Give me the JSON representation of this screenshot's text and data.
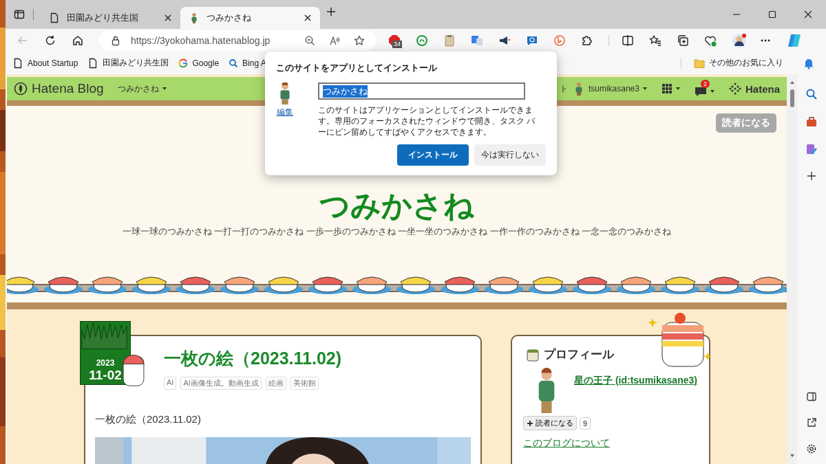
{
  "browser": {
    "tabs": [
      {
        "title": "田園みどり共生国",
        "selected": false
      },
      {
        "title": "つみかさね",
        "selected": true
      }
    ],
    "address": "https://3yokohama.hatenablog.jp",
    "extension_badge": "34",
    "bookmarks": [
      {
        "label": "About Startup"
      },
      {
        "label": "田園みどり共生国"
      },
      {
        "label": "Google"
      },
      {
        "label": "Bing A"
      }
    ],
    "other_bookmarks": "その他のお気に入り"
  },
  "install_dialog": {
    "title": "このサイトをアプリとしてインストール",
    "edit_link": "編集",
    "name_value": "つみかさね",
    "description": "このサイトはアプリケーションとしてインストールできます。専用のフォーカスされたウィンドウで開き、タスク バーにピン留めしてすばやくアクセスできます。",
    "buttons": [
      {
        "label": "インストール",
        "kind": "primary"
      },
      {
        "label": "今は実行しない",
        "kind": "secondary"
      }
    ]
  },
  "hatena_bar": {
    "logo": "Hatena Blog",
    "blog_menu": "つみかさね",
    "partial_item": "ト",
    "user": "tsumikasane3",
    "notification_count": "2",
    "brand": "Hatena"
  },
  "blog": {
    "subscribe": "読者になる",
    "title": "つみかさね",
    "description": "一球一球のつみかさね 一打一打のつみかさね 一歩一歩のつみかさね 一坐一坐のつみかさね 一作一作のつみかさね 一念一念のつみかさね"
  },
  "post": {
    "year": "2023",
    "date": "11-02",
    "title": "一枚の絵（2023.11.02)",
    "tags": [
      "AI",
      "AI画像生成。動画生成",
      "絵画",
      "美術館"
    ],
    "body": "一枚の絵（2023.11.02)"
  },
  "profile": {
    "heading": "プロフィール",
    "name": "星の王子 (id:tsumikasane3)",
    "subscribe": "読者になる",
    "reader_count": "9",
    "about_link": "このブログについて"
  }
}
